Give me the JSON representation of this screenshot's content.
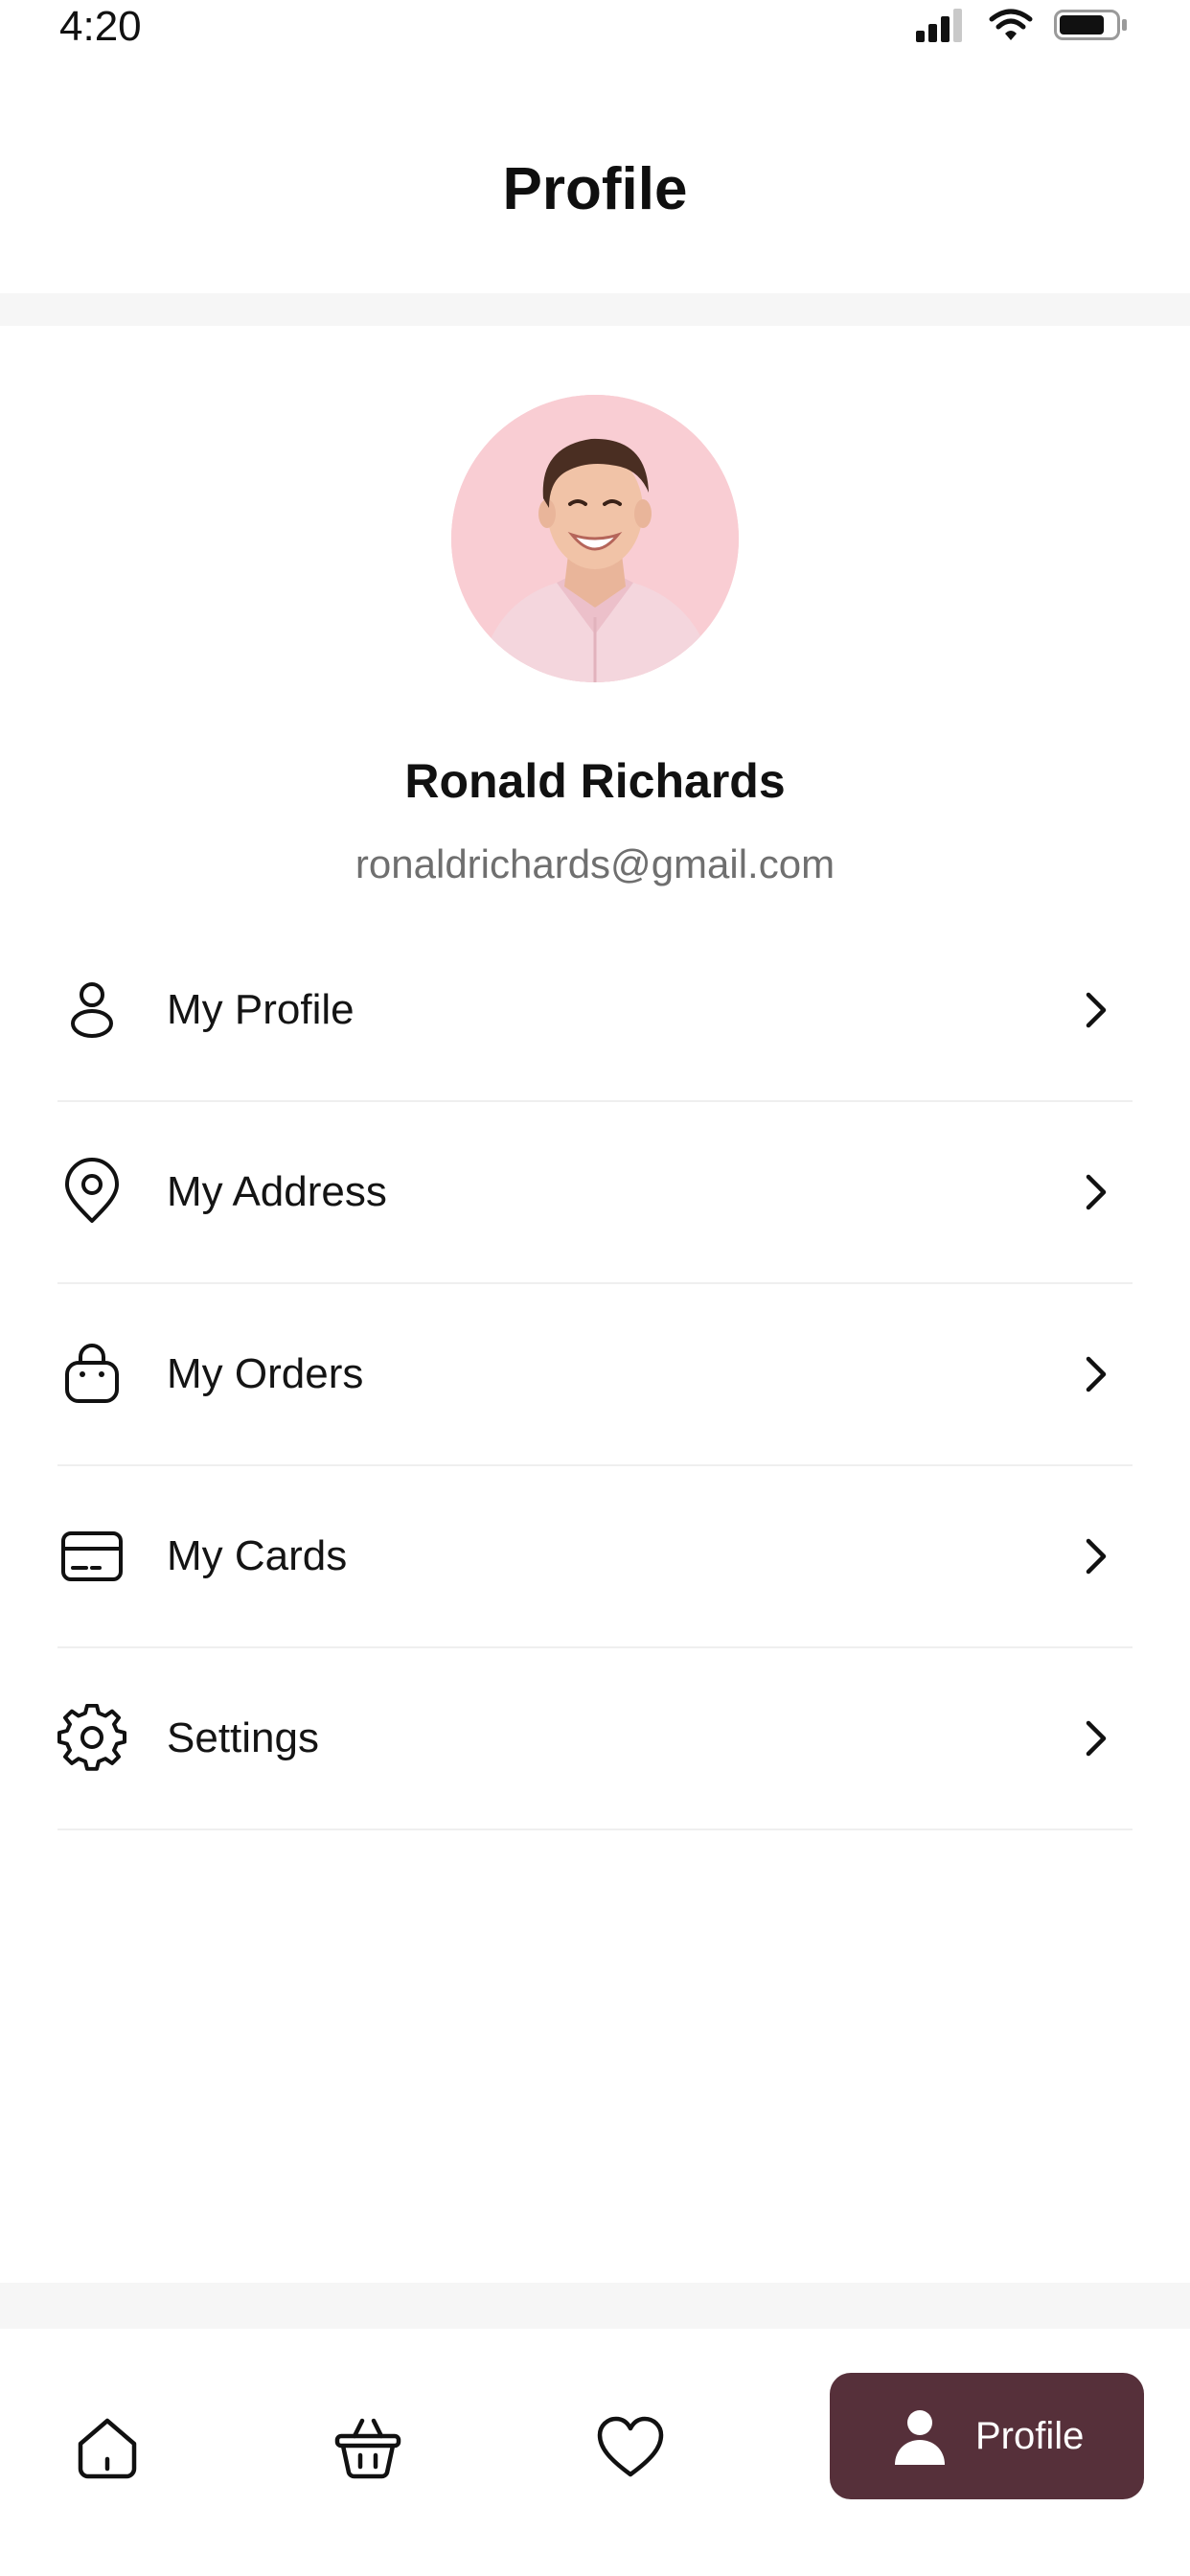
{
  "status_bar": {
    "time": "4:20",
    "icons": [
      "cellular-signal-icon",
      "wifi-icon",
      "battery-icon"
    ]
  },
  "header": {
    "title": "Profile"
  },
  "user": {
    "name": "Ronald Richards",
    "email": "ronaldrichards@gmail.com",
    "avatar_bg": "#f9cdd3"
  },
  "menu": {
    "items": [
      {
        "label": "My Profile",
        "icon": "person-icon"
      },
      {
        "label": "My Address",
        "icon": "location-pin-icon"
      },
      {
        "label": "My Orders",
        "icon": "shopping-bag-icon"
      },
      {
        "label": "My Cards",
        "icon": "credit-card-icon"
      },
      {
        "label": "Settings",
        "icon": "gear-icon"
      }
    ],
    "chevron_icon": "chevron-right-icon"
  },
  "bottom_nav": {
    "items": [
      {
        "icon": "home-icon"
      },
      {
        "icon": "basket-icon"
      },
      {
        "icon": "heart-icon"
      },
      {
        "icon": "person-icon",
        "label": "Profile",
        "active": true
      }
    ],
    "active_color": "#56303a"
  }
}
